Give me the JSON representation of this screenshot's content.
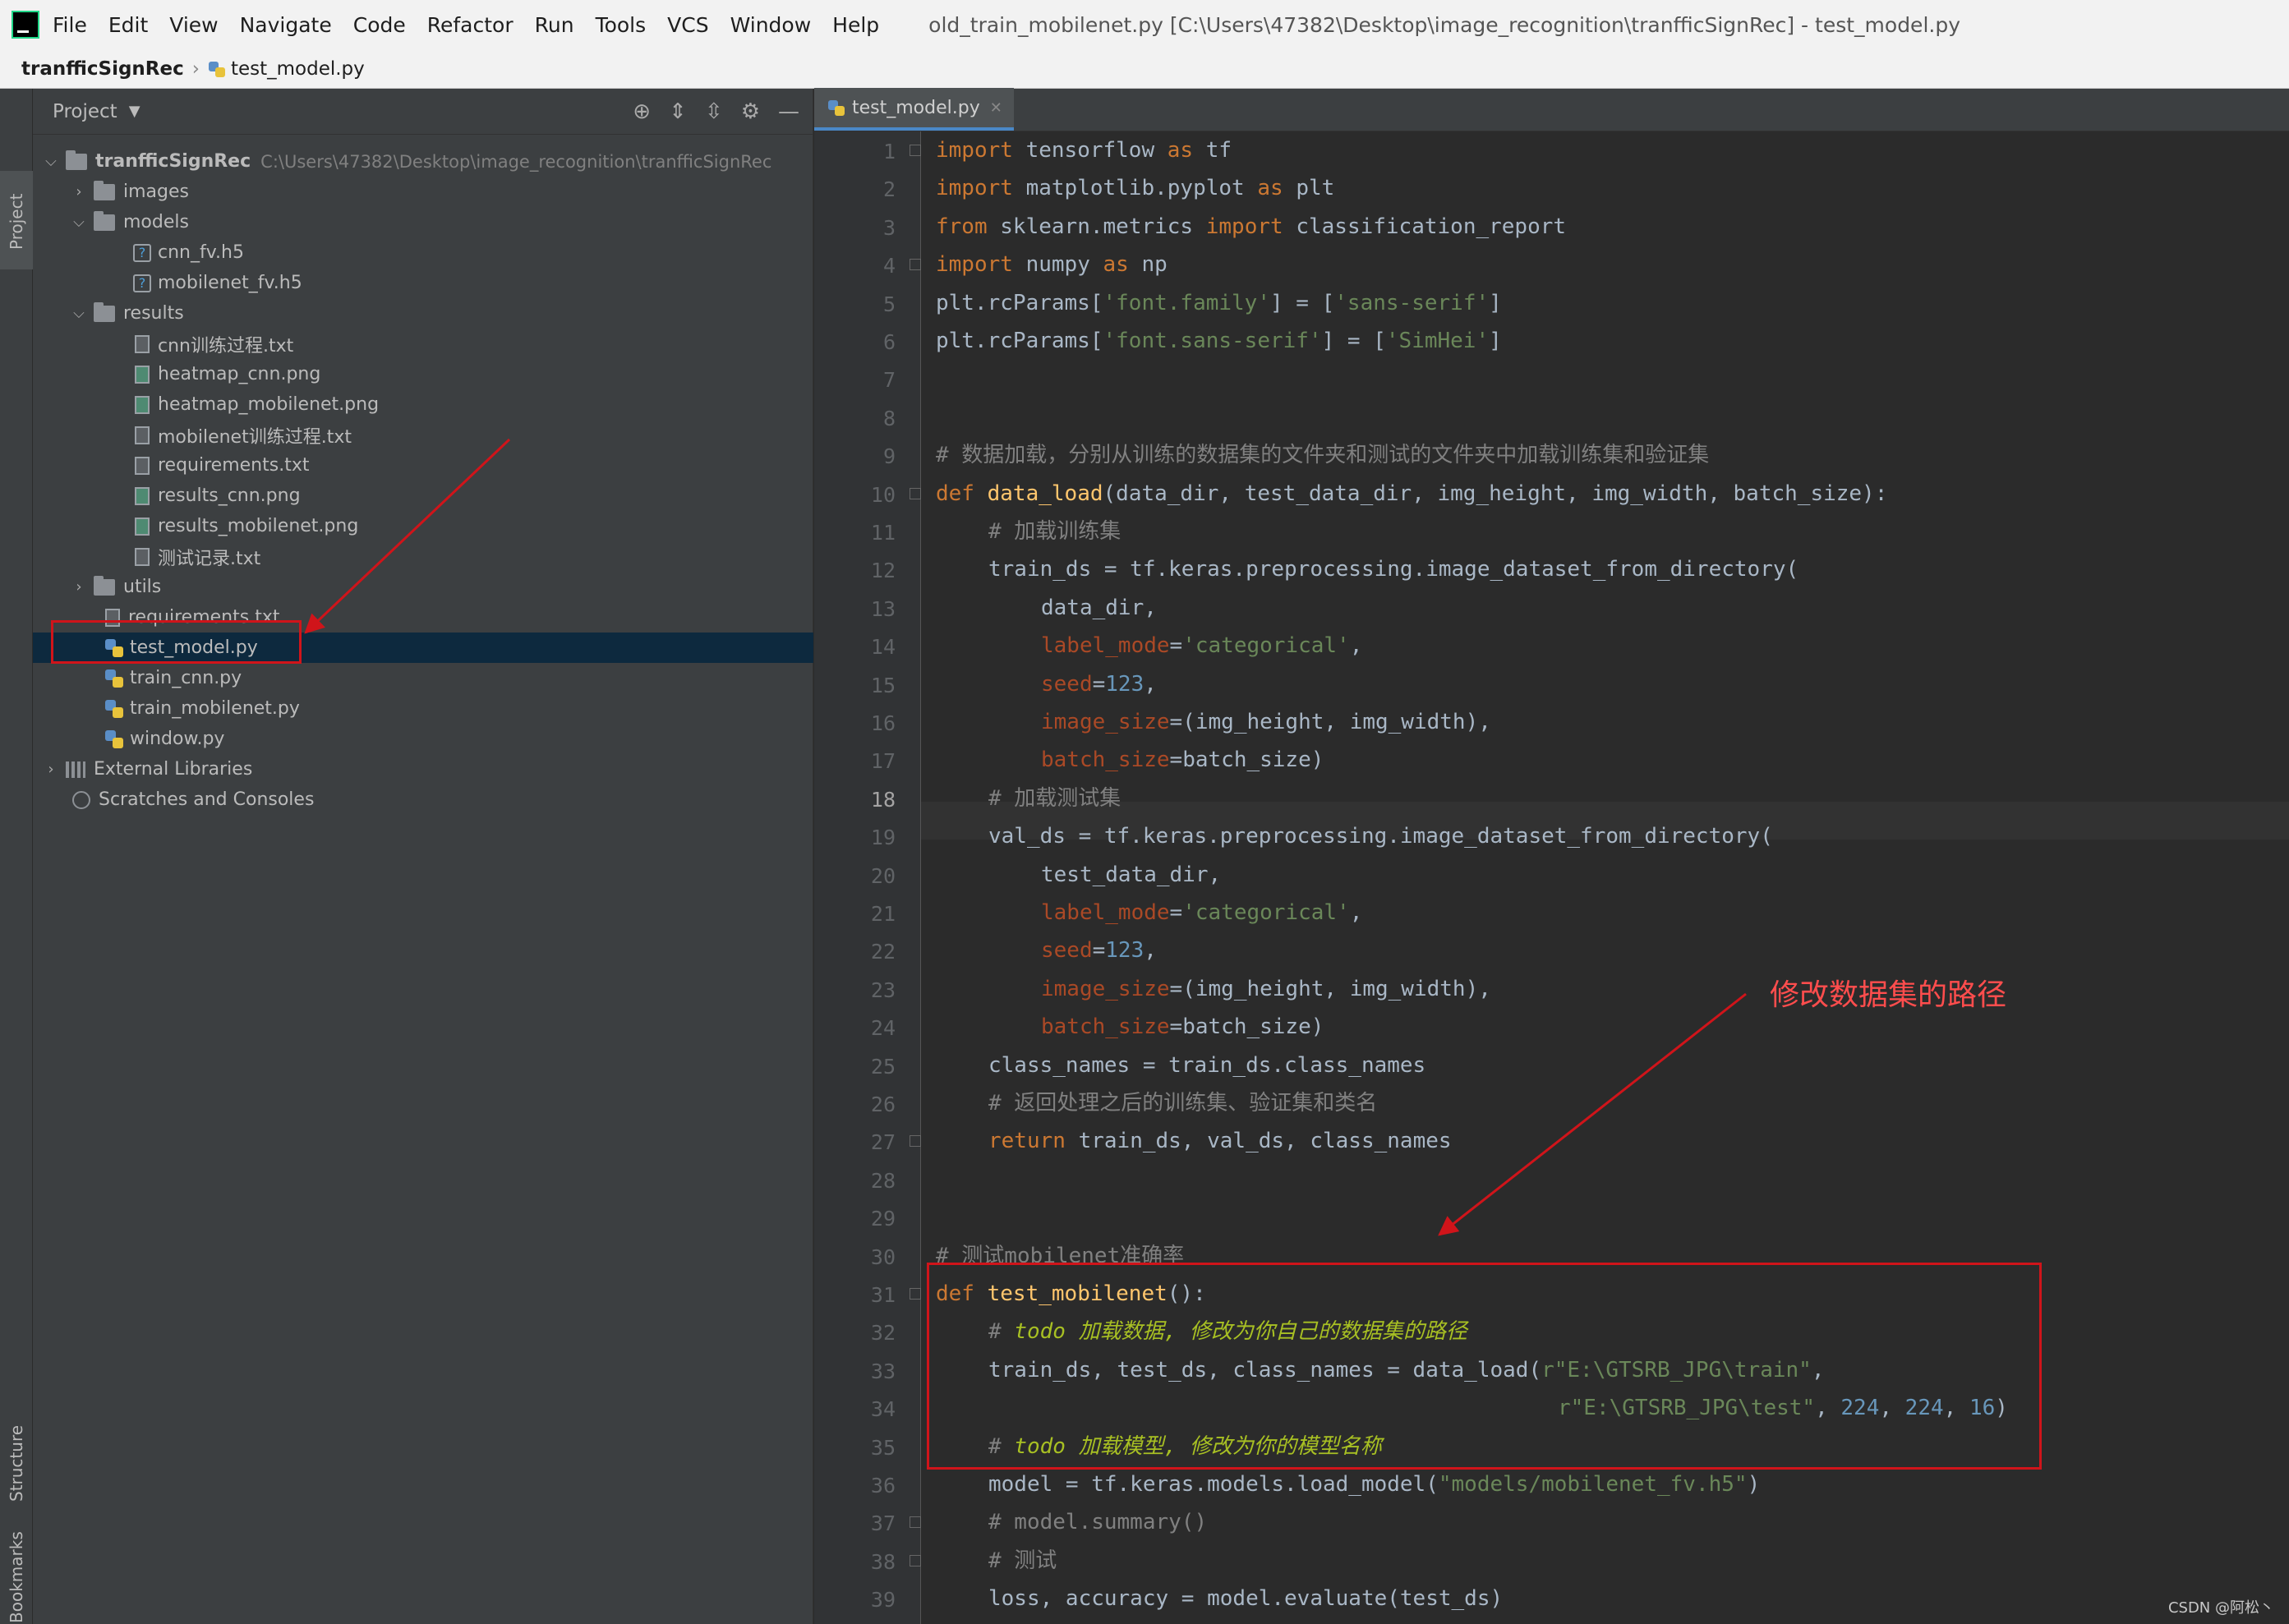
{
  "menubar": {
    "items": [
      "File",
      "Edit",
      "View",
      "Navigate",
      "Code",
      "Refactor",
      "Run",
      "Tools",
      "VCS",
      "Window",
      "Help"
    ],
    "title": "old_train_mobilenet.py [C:\\Users\\47382\\Desktop\\image_recognition\\tranfficSignRec] - test_model.py"
  },
  "breadcrumb": {
    "project": "tranfficSignRec",
    "file": "test_model.py"
  },
  "left_strip": {
    "project_tab": "Project",
    "structure_tab": "Structure",
    "bookmarks_tab": "Bookmarks"
  },
  "project_panel": {
    "header": "Project",
    "tree": [
      {
        "label": "tranfficSignRec",
        "path": "C:\\Users\\47382\\Desktop\\image_recognition\\tranfficSignRec"
      },
      {
        "label": "images"
      },
      {
        "label": "models"
      },
      {
        "label": "cnn_fv.h5"
      },
      {
        "label": "mobilenet_fv.h5"
      },
      {
        "label": "results"
      },
      {
        "label": "cnn训练过程.txt"
      },
      {
        "label": "heatmap_cnn.png"
      },
      {
        "label": "heatmap_mobilenet.png"
      },
      {
        "label": "mobilenet训练过程.txt"
      },
      {
        "label": "requirements.txt"
      },
      {
        "label": "results_cnn.png"
      },
      {
        "label": "results_mobilenet.png"
      },
      {
        "label": "测试记录.txt"
      },
      {
        "label": "utils"
      },
      {
        "label": "requirements.txt"
      },
      {
        "label": "test_model.py"
      },
      {
        "label": "train_cnn.py"
      },
      {
        "label": "train_mobilenet.py"
      },
      {
        "label": "window.py"
      },
      {
        "label": "External Libraries"
      },
      {
        "label": "Scratches and Consoles"
      }
    ]
  },
  "editor": {
    "tab": "test_model.py",
    "current_line": 18,
    "line_numbers": [
      "1",
      "2",
      "3",
      "4",
      "5",
      "6",
      "7",
      "8",
      "9",
      "10",
      "11",
      "12",
      "13",
      "14",
      "15",
      "16",
      "17",
      "18",
      "19",
      "20",
      "21",
      "22",
      "23",
      "24",
      "25",
      "26",
      "27",
      "28",
      "29",
      "30",
      "31",
      "32",
      "33",
      "34",
      "35",
      "36",
      "37",
      "38",
      "39"
    ],
    "code": {
      "l1": [
        "import",
        "tensorflow",
        "as",
        "tf"
      ],
      "l2": [
        "import",
        "matplotlib.pyplot",
        "as",
        "plt"
      ],
      "l3": [
        "from",
        "sklearn.metrics",
        "import",
        "classification_report"
      ],
      "l4": [
        "import",
        "numpy",
        "as",
        "np"
      ],
      "l5": [
        "plt.rcParams[",
        "'font.family'",
        "] = [",
        "'sans-serif'",
        "]"
      ],
      "l6": [
        "plt.rcParams[",
        "'font.sans-serif'",
        "] = [",
        "'SimHei'",
        "]"
      ],
      "l9": "# 数据加载，分别从训练的数据集的文件夹和测试的文件夹中加载训练集和验证集",
      "l10": [
        "def",
        "data_load",
        "(data_dir, test_data_dir, img_height, img_width, batch_size):"
      ],
      "l11": "# 加载训练集",
      "l12": "train_ds = tf.keras.preprocessing.image_dataset_from_directory(",
      "l13": "data_dir,",
      "l14": [
        "label_mode",
        "=",
        "'categorical'",
        ","
      ],
      "l15": [
        "seed",
        "=",
        "123",
        ","
      ],
      "l16": [
        "image_size",
        "=(img_height, img_width),"
      ],
      "l17": [
        "batch_size",
        "=batch_size)"
      ],
      "l18": "# 加载测试集",
      "l19": "val_ds = tf.keras.preprocessing.image_dataset_from_directory(",
      "l20": "test_data_dir,",
      "l21": [
        "label_mode",
        "=",
        "'categorical'",
        ","
      ],
      "l22": [
        "seed",
        "=",
        "123",
        ","
      ],
      "l23": [
        "image_size",
        "=(img_height, img_width),"
      ],
      "l24": [
        "batch_size",
        "=batch_size)"
      ],
      "l25": "class_names = train_ds.class_names",
      "l26": "# 返回处理之后的训练集、验证集和类名",
      "l27": [
        "return",
        "train_ds, val_ds, class_names"
      ],
      "l30": "# 测试mobilenet准确率",
      "l31": [
        "def",
        "test_mobilenet",
        "():"
      ],
      "l32": [
        "# ",
        "todo",
        " 加载数据, 修改为你自己的数据集的路径"
      ],
      "l33": [
        "train_ds, test_ds, class_names = data_load(",
        "r\"E:\\GTSRB_JPG\\train\"",
        ","
      ],
      "l34": [
        "r\"E:\\GTSRB_JPG\\test\"",
        ", ",
        "224",
        ", ",
        "224",
        ", ",
        "16",
        ")"
      ],
      "l35": [
        "# ",
        "todo",
        " 加载模型, 修改为你的模型名称"
      ],
      "l36": [
        "model = tf.keras.models.load_model(",
        "\"models/mobilenet_fv.h5\"",
        ")"
      ],
      "l37": "# model.summary()",
      "l38": "# 测试",
      "l39": "loss, accuracy = model.evaluate(test_ds)"
    }
  },
  "annotation": {
    "text": "修改数据集的路径",
    "color": "#ff4d4d"
  },
  "watermark": "CSDN @阿松丶",
  "colors": {
    "keyword": "#cc7832",
    "function": "#ffc66d",
    "string": "#6a8759",
    "comment": "#808080",
    "number": "#6897bb",
    "param": "#aa4926",
    "selection": "#0d293e",
    "annotation_red": "#d0141a"
  }
}
